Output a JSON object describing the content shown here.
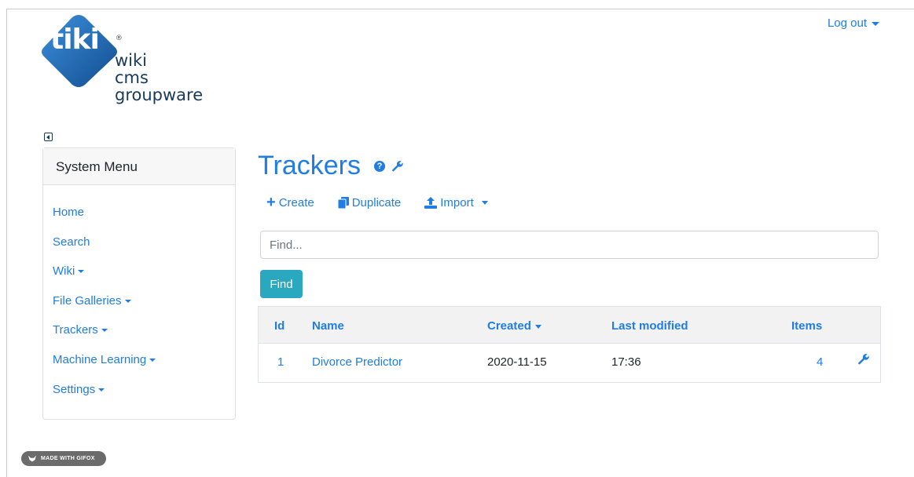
{
  "header": {
    "logo": {
      "word": "tiki",
      "reg": "®",
      "lines": [
        "wiki",
        "cms",
        "groupware"
      ]
    },
    "logout_label": "Log out"
  },
  "sidebar": {
    "title": "System Menu",
    "items": [
      {
        "label": "Home",
        "has_caret": false
      },
      {
        "label": "Search",
        "has_caret": false
      },
      {
        "label": "Wiki",
        "has_caret": true
      },
      {
        "label": "File Galleries",
        "has_caret": true
      },
      {
        "label": "Trackers",
        "has_caret": true
      },
      {
        "label": "Machine Learning",
        "has_caret": true
      },
      {
        "label": "Settings",
        "has_caret": true
      }
    ]
  },
  "main": {
    "title": "Trackers",
    "actions": {
      "create": "Create",
      "duplicate": "Duplicate",
      "import": "Import"
    },
    "search": {
      "placeholder": "Find...",
      "button": "Find"
    },
    "table": {
      "headers": {
        "id": "Id",
        "name": "Name",
        "created": "Created",
        "last_modified": "Last modified",
        "items": "Items"
      },
      "rows": [
        {
          "id": "1",
          "name": "Divorce Predictor",
          "created": "2020-11-15",
          "last_modified": "17:36",
          "items": "4"
        }
      ]
    }
  },
  "badge": {
    "label": "MADE WITH GIFOX"
  },
  "colors": {
    "link": "#1f7de3",
    "find_button": "#2aa8bf",
    "logo_blue": "#1a6fc0"
  }
}
